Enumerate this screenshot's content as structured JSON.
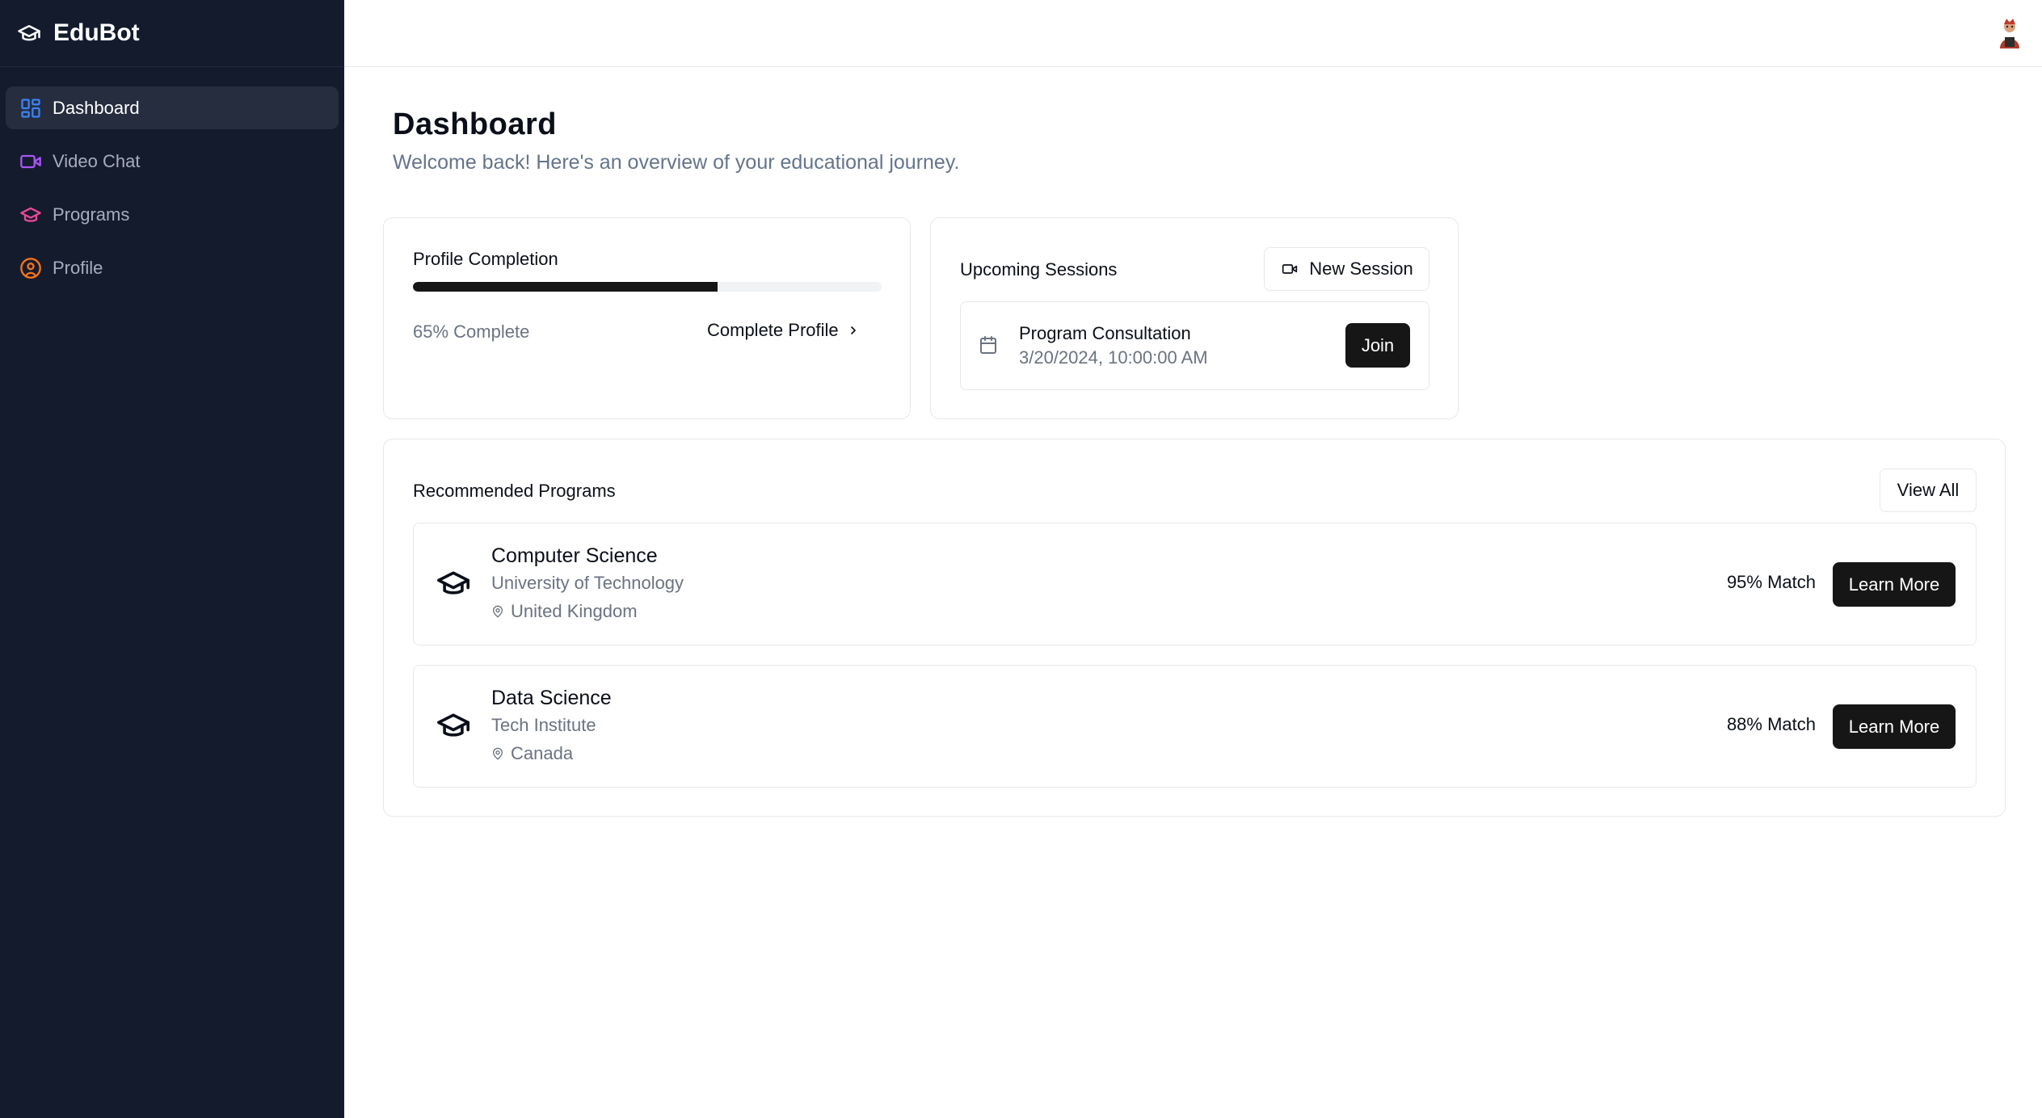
{
  "app": {
    "name": "EduBot"
  },
  "sidebar": {
    "items": [
      {
        "label": "Dashboard",
        "icon": "layout-grid-icon",
        "color": "#3b82f6",
        "active": true
      },
      {
        "label": "Video Chat",
        "icon": "video-icon",
        "color": "#a855f7",
        "active": false
      },
      {
        "label": "Programs",
        "icon": "graduation-cap-icon",
        "color": "#ec4899",
        "active": false
      },
      {
        "label": "Profile",
        "icon": "user-circle-icon",
        "color": "#f97316",
        "active": false
      }
    ]
  },
  "header": {
    "avatar_icon": "user-avatar"
  },
  "page": {
    "title": "Dashboard",
    "subtitle": "Welcome back! Here's an overview of your educational journey."
  },
  "profile_completion": {
    "title": "Profile Completion",
    "progress_percent": 65,
    "progress_text": "65% Complete",
    "link_label": "Complete Profile"
  },
  "upcoming_sessions": {
    "title": "Upcoming Sessions",
    "new_session_label": "New Session",
    "sessions": [
      {
        "title": "Program Consultation",
        "time": "3/20/2024, 10:00:00 AM",
        "action_label": "Join"
      }
    ]
  },
  "recommended_programs": {
    "title": "Recommended Programs",
    "view_all_label": "View All",
    "programs": [
      {
        "name": "Computer Science",
        "institution": "University of Technology",
        "location": "United Kingdom",
        "match": "95% Match",
        "action_label": "Learn More"
      },
      {
        "name": "Data Science",
        "institution": "Tech Institute",
        "location": "Canada",
        "match": "88% Match",
        "action_label": "Learn More"
      }
    ]
  },
  "colors": {
    "sidebar_bg": "#141b2d",
    "primary_button": "#161616",
    "accent": "#3b82f6"
  }
}
